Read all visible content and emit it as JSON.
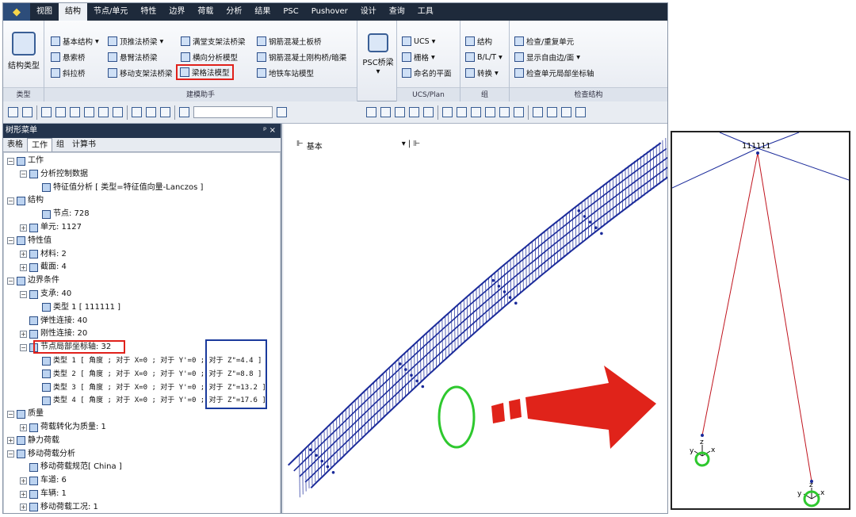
{
  "menu": {
    "items": [
      "视图",
      "结构",
      "节点/单元",
      "特性",
      "边界",
      "荷载",
      "分析",
      "结果",
      "PSC",
      "Pushover",
      "设计",
      "查询",
      "工具"
    ],
    "active_index": 1
  },
  "ribbon": {
    "type_group": {
      "button": "结构类型",
      "label": "类型"
    },
    "wizard_group": {
      "label": "建模助手",
      "items": [
        "基本结构",
        "悬索桥",
        "斜拉桥",
        "顶推法桥梁",
        "悬臂法桥梁",
        "移动支架法桥梁",
        "满堂支架法桥梁",
        "横向分析模型",
        "梁格法模型",
        "钢筋混凝土板桥",
        "钢筋混凝土刚构桥/暗渠",
        "地铁车站模型"
      ],
      "highlighted": "梁格法模型"
    },
    "psc": {
      "button": "PSC桥梁"
    },
    "ucs_group": {
      "label": "UCS/Plan",
      "items": [
        "UCS",
        "栅格",
        "命名的平面"
      ]
    },
    "group_group": {
      "label": "组",
      "items": [
        "结构",
        "B/L/T",
        "转换"
      ]
    },
    "check_group": {
      "label": "检查结构",
      "items": [
        "检查/重复单元",
        "显示自由边/面",
        "检查单元局部坐标轴"
      ]
    }
  },
  "panel": {
    "title": "树形菜单",
    "pin": "ᵖ ×",
    "tabs": [
      "表格",
      "工作",
      "组",
      "计算书"
    ],
    "active_tab": 1,
    "tree": [
      "工作",
      "分析控制数据",
      "特征值分析 [ 类型=特征值向量-Lanczos ]",
      "结构",
      "节点: 728",
      "单元: 1127",
      "特性值",
      "材料: 2",
      "截面: 4",
      "边界条件",
      "支承: 40",
      "类型 1 [ 111111 ]",
      "弹性连接: 40",
      "刚性连接: 20",
      "节点局部坐标轴: 32",
      "类型 1 [ 角度 ; 对于 X=0 ; 对于 Y'=0 ; 对于 Z\"=4.4 ]",
      "类型 2 [ 角度 ; 对于 X=0 ; 对于 Y'=0 ; 对于 Z\"=8.8 ]",
      "类型 3 [ 角度 ; 对于 X=0 ; 对于 Y'=0 ; 对于 Z\"=13.2 ]",
      "类型 4 [ 角度 ; 对于 X=0 ; 对于 Y'=0 ; 对于 Z\"=17.6 ]",
      "质量",
      "荷载转化为质量: 1",
      "静力荷载",
      "移动荷载分析",
      "移动荷载规范[ China ]",
      "车道: 6",
      "车辆: 1",
      "移动荷载工况: 1"
    ]
  },
  "viewport": {
    "view_label": "基本"
  },
  "detail": {
    "support_label": "111111",
    "axes": [
      "y",
      "z",
      "x"
    ]
  },
  "colors": {
    "mesh": "#1a2a9a",
    "link": "#c0141e",
    "arrow": "#e0231a",
    "circle": "#2ec82e",
    "highlight_box": "#e0211b",
    "value_box": "#1a3a9c"
  }
}
